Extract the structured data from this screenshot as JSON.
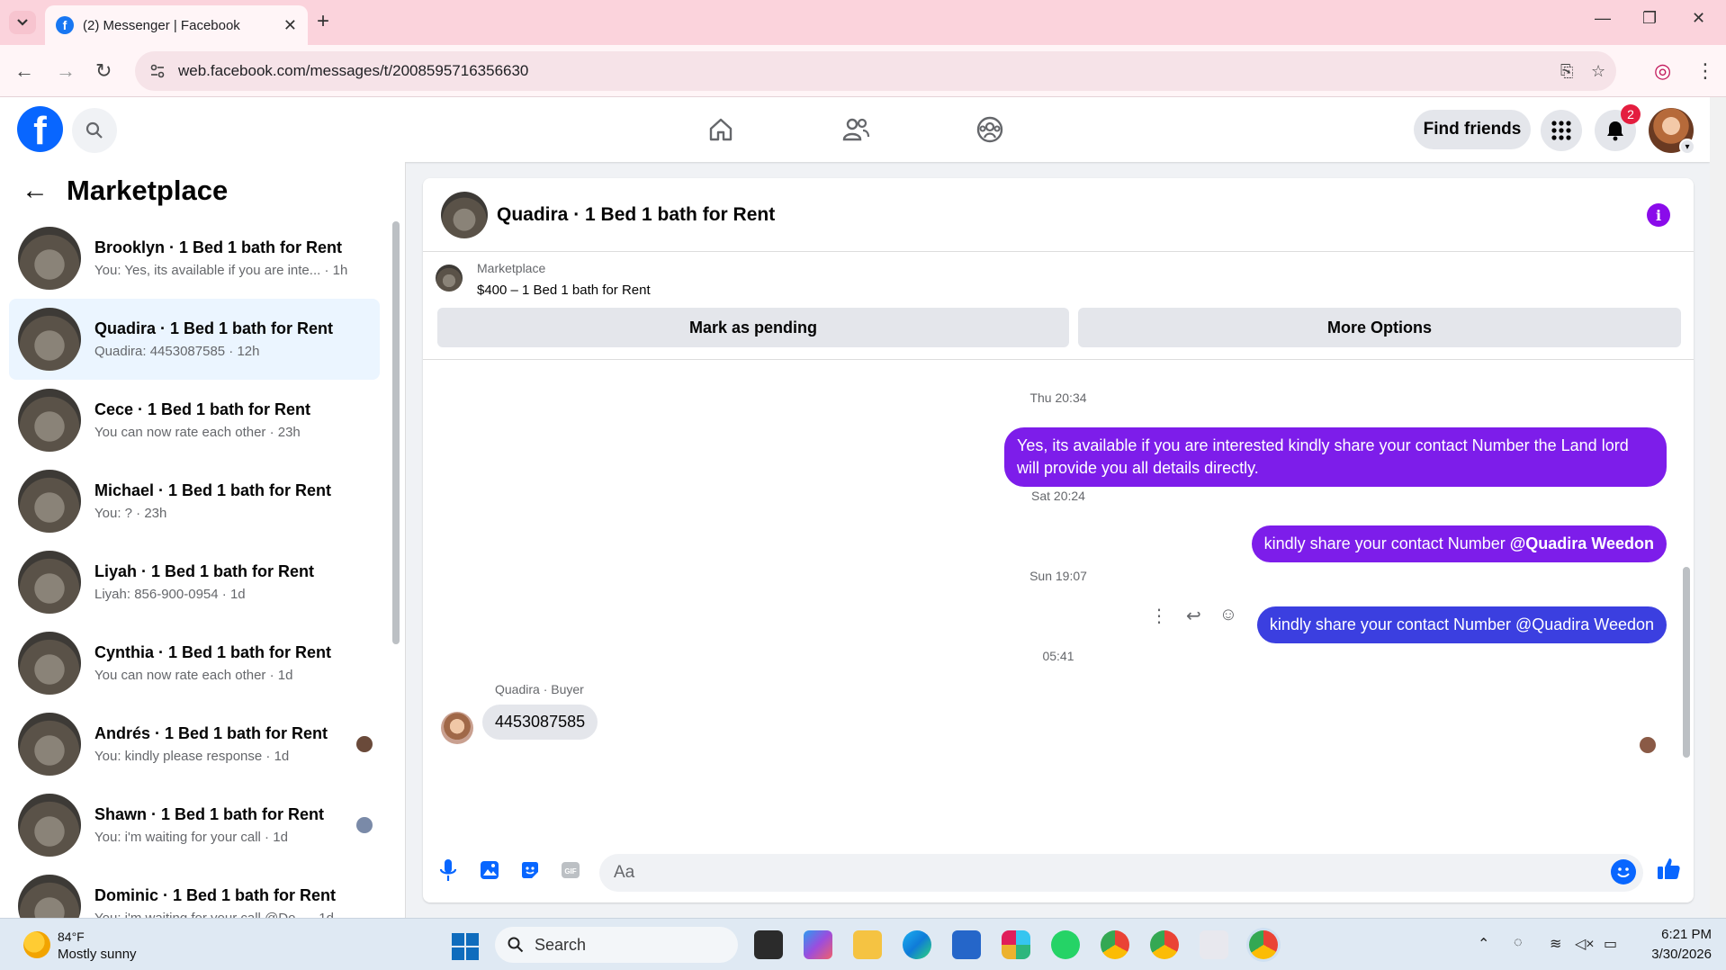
{
  "browser": {
    "tab_title": "(2) Messenger | Facebook",
    "url": "web.facebook.com/messages/t/2008595716356630"
  },
  "header": {
    "find_friends_label": "Find friends",
    "notification_count": "2"
  },
  "sidebar": {
    "title": "Marketplace",
    "conversations": [
      {
        "name": "Brooklyn · 1 Bed 1 bath for Rent",
        "preview": "You: Yes, its available if you are inte... · 1h"
      },
      {
        "name": "Quadira · 1 Bed 1 bath for Rent",
        "preview": "Quadira: 4453087585 · 12h"
      },
      {
        "name": "Cece · 1 Bed 1 bath for Rent",
        "preview": "You can now rate each other · 23h"
      },
      {
        "name": "Michael · 1 Bed 1 bath for Rent",
        "preview": "You: ? · 23h"
      },
      {
        "name": "Liyah · 1 Bed 1 bath for Rent",
        "preview": "Liyah: 856-900-0954 · 1d"
      },
      {
        "name": "Cynthia · 1 Bed 1 bath for Rent",
        "preview": "You can now rate each other · 1d"
      },
      {
        "name": "Andrés · 1 Bed 1 bath for Rent",
        "preview": "You: kindly please response · 1d"
      },
      {
        "name": "Shawn · 1 Bed 1 bath for Rent",
        "preview": "You: i'm waiting for your call · 1d"
      },
      {
        "name": "Dominic · 1 Bed 1 bath for Rent",
        "preview": "You: i'm waiting for your call @Do... · 1d"
      }
    ]
  },
  "chat": {
    "title": "Quadira · 1 Bed 1 bath for Rent",
    "listing": {
      "label": "Marketplace",
      "price_title": "$400 – 1 Bed 1 bath for Rent",
      "mark_pending": "Mark as pending",
      "more_options": "More Options"
    },
    "messages": {
      "ts1": "Thu 20:34",
      "msg1": "Yes, its available if you are interested kindly share your contact Number the Land lord will provide you all details directly.",
      "ts2": "Sat 20:24",
      "msg2_text": "kindly share your contact Number ",
      "msg2_mention": "@Quadira Weedon",
      "ts3": "Sun 19:07",
      "msg3": "kindly share your contact Number @Quadira Weedon",
      "ts4": "05:41",
      "sender_label": "Quadira · Buyer",
      "incoming": "4453087585"
    },
    "composer_placeholder": "Aa"
  },
  "taskbar": {
    "temperature": "84°F",
    "weather": "Mostly sunny",
    "search_label": "Search",
    "time": "6:21 PM",
    "date": "3/30/2026"
  }
}
